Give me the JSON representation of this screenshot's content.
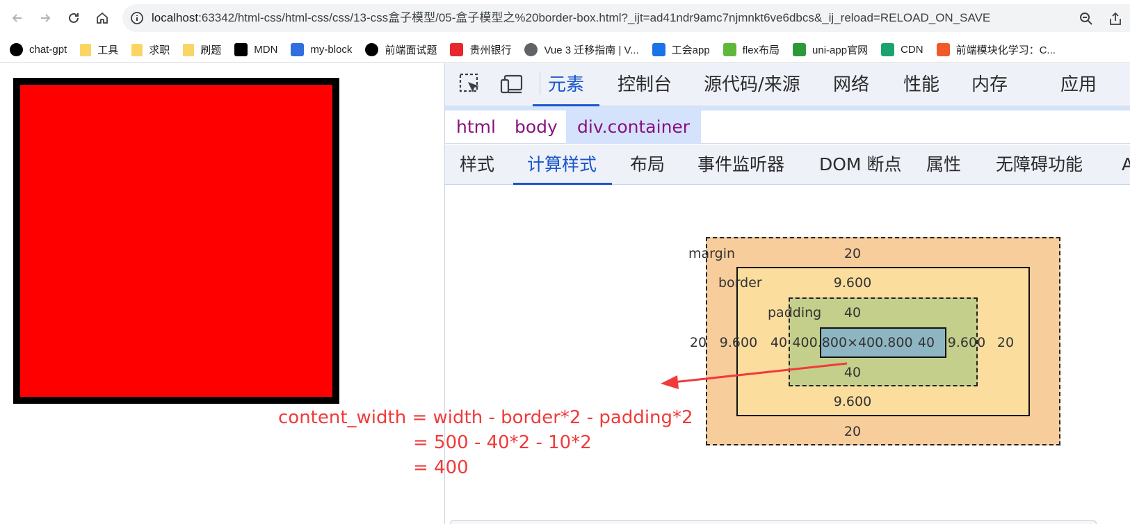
{
  "browser": {
    "url_host": "localhost",
    "url_rest": ":63342/html-css/html-css/css/13-css盒子模型/05-盒子模型之%20border-box.html?_ijt=ad41ndr9amc7njmnkt6ve6dbcs&_ij_reload=RELOAD_ON_SAVE"
  },
  "bookmarks": [
    {
      "label": "chat-gpt",
      "icon": "openai-icon",
      "color": "#000000"
    },
    {
      "label": "工具",
      "icon": "folder-icon",
      "color": "#f9d664"
    },
    {
      "label": "求职",
      "icon": "folder-icon",
      "color": "#f9d664"
    },
    {
      "label": "刷题",
      "icon": "folder-icon",
      "color": "#f9d664"
    },
    {
      "label": "MDN",
      "icon": "mdn-icon",
      "color": "#000000"
    },
    {
      "label": "my-block",
      "icon": "block-icon",
      "color": "#2f6fde"
    },
    {
      "label": "前端面试题",
      "icon": "github-icon",
      "color": "#000000"
    },
    {
      "label": "贵州银行",
      "icon": "bank-icon",
      "color": "#e8262d"
    },
    {
      "label": "Vue 3 迁移指南 | V...",
      "icon": "globe-icon",
      "color": "#5f6368"
    },
    {
      "label": "工会app",
      "icon": "cloud-icon",
      "color": "#1a73e8"
    },
    {
      "label": "flex布局",
      "icon": "frog-icon",
      "color": "#5fb83a"
    },
    {
      "label": "uni-app官网",
      "icon": "uniapp-icon",
      "color": "#2b9939"
    },
    {
      "label": "CDN",
      "icon": "cdn-icon",
      "color": "#1aa36f"
    },
    {
      "label": "前端模块化学习：C...",
      "icon": "c-icon",
      "color": "#f05a28"
    }
  ],
  "devtools": {
    "tabs": [
      "元素",
      "控制台",
      "源代码/来源",
      "网络",
      "性能",
      "内存",
      "应用"
    ],
    "active_tab": "元素",
    "breadcrumb": [
      "html",
      "body",
      "div.container"
    ],
    "subtabs": [
      "样式",
      "计算样式",
      "布局",
      "事件监听器",
      "DOM 断点",
      "属性",
      "无障碍功能",
      "A"
    ],
    "active_subtab": "计算样式",
    "box_model": {
      "margin_label": "margin",
      "border_label": "border",
      "padding_label": "padding",
      "margin": {
        "top": "20",
        "right": "20",
        "bottom": "20",
        "left": "20"
      },
      "border": {
        "top": "9.600",
        "right": "9.600",
        "bottom": "9.600",
        "left": "9.600"
      },
      "padding": {
        "top": "40",
        "right": "40",
        "bottom": "40",
        "left": "40"
      },
      "content": "400.800×400.800"
    }
  },
  "page": {
    "box_color": "#ff0000",
    "box_border_color": "#000000"
  },
  "annotation": {
    "line1": "content_width = width - border*2 - padding*2",
    "line2": "= 500 - 40*2 - 10*2",
    "line3": "= 400",
    "color": "#f13a3a"
  }
}
